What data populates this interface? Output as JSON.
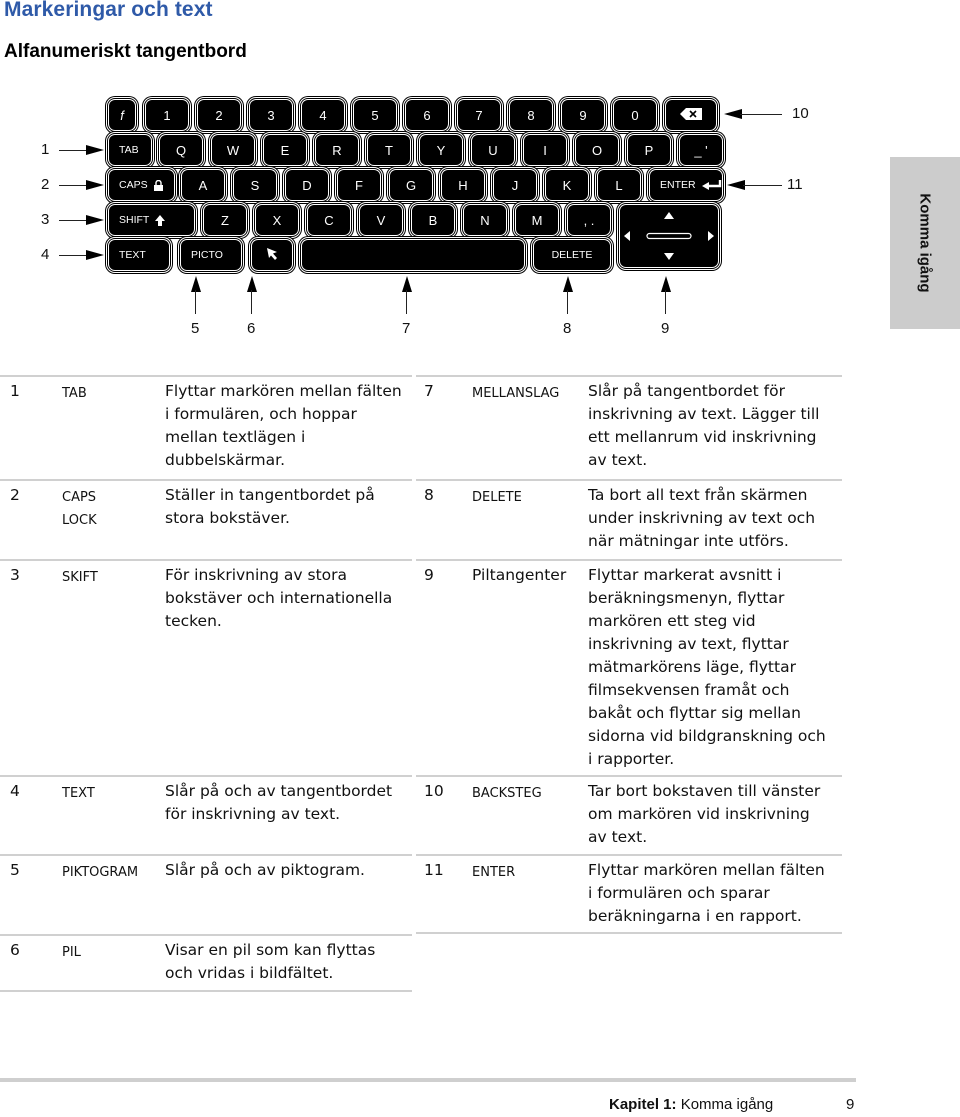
{
  "page": {
    "title": "Markeringar och text",
    "subtitle": "Alfanumeriskt tangentbord",
    "side_tab": "Komma igång"
  },
  "keyboard": {
    "row1": [
      "f",
      "1",
      "2",
      "3",
      "4",
      "5",
      "6",
      "7",
      "8",
      "9",
      "0"
    ],
    "backspace_icon": "backspace-icon",
    "row2_tab": "TAB",
    "row2": [
      "Q",
      "W",
      "E",
      "R",
      "T",
      "Y",
      "U",
      "I",
      "O",
      "P"
    ],
    "row2_last": "_ '",
    "row3_caps": "CAPS",
    "row3": [
      "A",
      "S",
      "D",
      "F",
      "G",
      "H",
      "J",
      "K",
      "L"
    ],
    "row3_enter": "ENTER",
    "row4_shift": "SHIFT",
    "row4": [
      "Z",
      "X",
      "C",
      "V",
      "B",
      "N",
      "M",
      ", ."
    ],
    "row5_text": "TEXT",
    "row5_picto": "PICTO",
    "row5_delete": "DELETE",
    "callouts": {
      "left": [
        "1",
        "2",
        "3",
        "4"
      ],
      "right": [
        "10",
        "11"
      ],
      "bottom": [
        "5",
        "6",
        "7",
        "8",
        "9"
      ]
    }
  },
  "table": {
    "left": [
      {
        "num": "1",
        "key": "TAB",
        "desc": [
          "Flyttar markören mellan fälten",
          "i formulären, och hoppar",
          "mellan textlägen i",
          "dubbelskärmar."
        ]
      },
      {
        "num": "2",
        "key": [
          "CAPS",
          "LOCK"
        ],
        "desc": [
          "Ställer in tangentbordet på",
          "stora bokstäver."
        ]
      },
      {
        "num": "3",
        "key": "SKIFT",
        "desc": [
          "För inskrivning av stora",
          "bokstäver och internationella",
          "tecken."
        ]
      },
      {
        "num": "4",
        "key": "TEXT",
        "desc": [
          "Slår på och av tangentbordet",
          "för inskrivning av text."
        ]
      },
      {
        "num": "5",
        "key": "PIKTOGRAM",
        "desc": [
          "Slår på och av piktogram."
        ]
      },
      {
        "num": "6",
        "key": "PIL",
        "desc": [
          "Visar en pil som kan flyttas",
          "och vridas i bildfältet."
        ]
      }
    ],
    "right": [
      {
        "num": "7",
        "key": "MELLANSLAG",
        "desc": [
          "Slår på tangentbordet för",
          "inskrivning av text. Lägger till",
          "ett mellanrum vid inskrivning",
          "av text."
        ]
      },
      {
        "num": "8",
        "key": "DELETE",
        "desc": [
          "Ta bort all text från skärmen",
          "under inskrivning av text och",
          "när mätningar inte utförs."
        ]
      },
      {
        "num": "9",
        "key": "Piltangenter",
        "desc": [
          "Flyttar markerat avsnitt i",
          "beräkningsmenyn, flyttar",
          "markören ett steg vid",
          "inskrivning av text, flyttar",
          "mätmarkörens läge, flyttar",
          "filmsekvensen framåt och",
          "bakåt och flyttar sig mellan",
          "sidorna vid bildgranskning och",
          "i rapporter."
        ]
      },
      {
        "num": "10",
        "key": "BACKSTEG",
        "desc": [
          "Tar bort bokstaven till vänster",
          "om markören vid inskrivning",
          "av text."
        ]
      },
      {
        "num": "11",
        "key": "ENTER",
        "desc": [
          "Flyttar markören mellan fälten",
          "i formulären och sparar",
          "beräkningarna i en rapport."
        ]
      }
    ]
  },
  "footer": {
    "chapter_label": "Kapitel 1:",
    "chapter_title": "Komma igång",
    "page_number": "9"
  }
}
